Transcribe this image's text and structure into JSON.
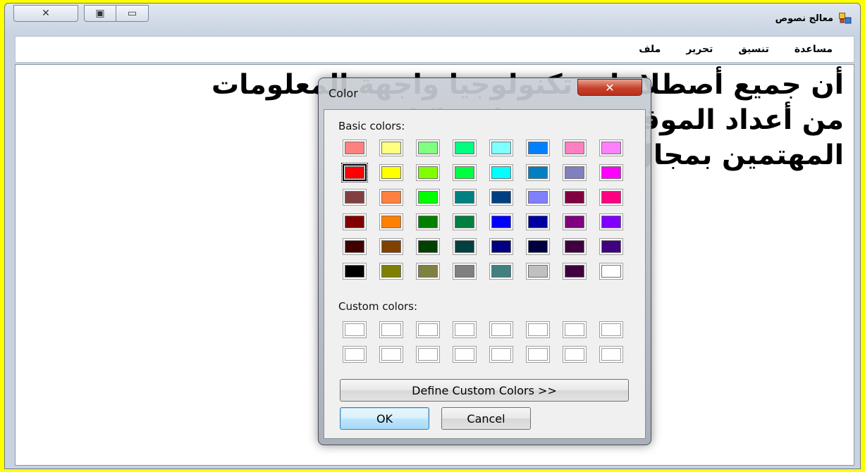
{
  "window": {
    "title": "معالج نصوص",
    "caption_buttons": {
      "close": "✕",
      "maximize": "▣",
      "minimize": "▭"
    }
  },
  "menu": {
    "items": [
      "ملف",
      "تحرير",
      "تنسيق",
      "مساعدة"
    ]
  },
  "editor": {
    "text": "أن جميع أصطلاحات تكنولوجيا واجهة المعلومات\nمن أعداد الموقع وهي مجانية لكل\nالمهتمين بمجال الحاسوب"
  },
  "dialog": {
    "title": "Color",
    "close_glyph": "✕",
    "basic_label": "Basic colors:",
    "custom_label": "Custom colors:",
    "define_button": "Define Custom Colors >>",
    "ok_button": "OK",
    "cancel_button": "Cancel",
    "selected_color": "#FF0000",
    "basic_colors": [
      [
        "#FF8080",
        "#FFFF80",
        "#80FF80",
        "#00FF80",
        "#80FFFF",
        "#0080FF",
        "#FF80C0",
        "#FF80FF"
      ],
      [
        "#FF0000",
        "#FFFF00",
        "#80FF00",
        "#00FF40",
        "#00FFFF",
        "#0080C0",
        "#8080C0",
        "#FF00FF"
      ],
      [
        "#804040",
        "#FF8040",
        "#00FF00",
        "#008080",
        "#004080",
        "#8080FF",
        "#800040",
        "#FF0080"
      ],
      [
        "#800000",
        "#FF8000",
        "#008000",
        "#008040",
        "#0000FF",
        "#0000A0",
        "#800080",
        "#8000FF"
      ],
      [
        "#400000",
        "#804000",
        "#004000",
        "#004040",
        "#000080",
        "#000040",
        "#400040",
        "#400080"
      ],
      [
        "#000000",
        "#808000",
        "#808040",
        "#808080",
        "#408080",
        "#C0C0C0",
        "#400040",
        "#FFFFFF"
      ]
    ],
    "custom_colors": [
      [
        "#FFFFFF",
        "#FFFFFF",
        "#FFFFFF",
        "#FFFFFF",
        "#FFFFFF",
        "#FFFFFF",
        "#FFFFFF",
        "#FFFFFF"
      ],
      [
        "#FFFFFF",
        "#FFFFFF",
        "#FFFFFF",
        "#FFFFFF",
        "#FFFFFF",
        "#FFFFFF",
        "#FFFFFF",
        "#FFFFFF"
      ]
    ]
  },
  "colors": {
    "desktop_background": "#FFFF00",
    "dialog_close": "#C7412A"
  }
}
